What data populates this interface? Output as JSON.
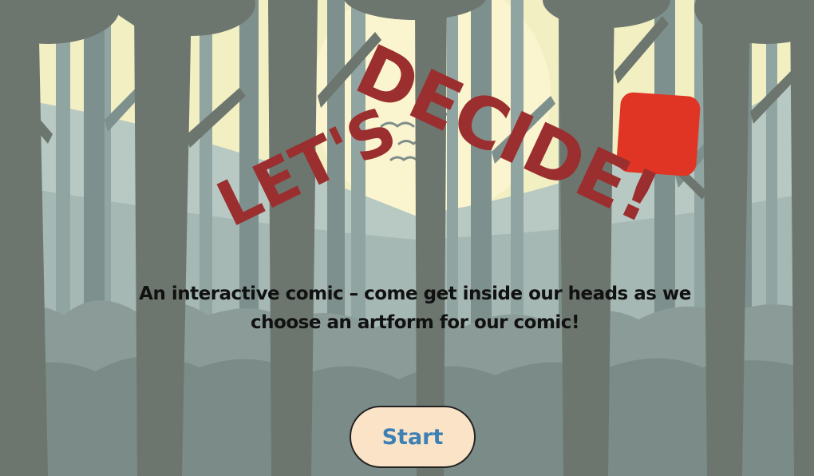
{
  "title": {
    "part1": "LET'S",
    "part2": "DECIDE!"
  },
  "subtitle": "An interactive comic – come get inside our heads as we choose an artform for our comic!",
  "start_button": {
    "label": "Start"
  },
  "colors": {
    "sky": "#f4f1c4",
    "moon": "#fbf6d0",
    "title_red": "#9b2e2e",
    "red_square": "#e03424",
    "button_bg": "#fbe3c8",
    "button_text": "#3d80b3"
  }
}
